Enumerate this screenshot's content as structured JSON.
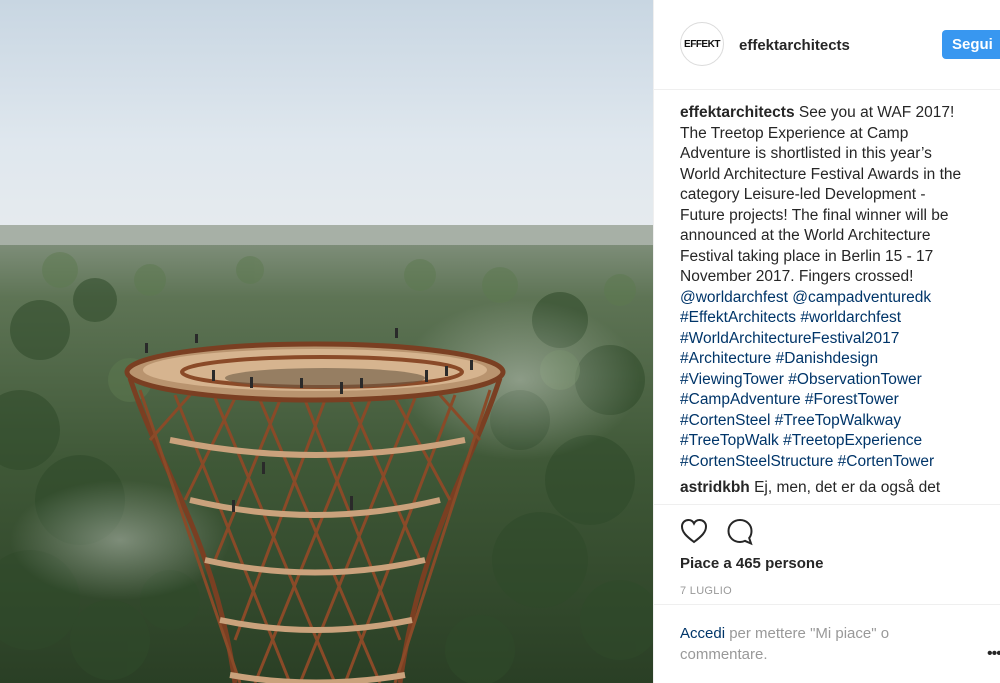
{
  "post": {
    "username": "effektarchitects",
    "avatar_text": "EFFEKT",
    "follow_label": "Segui",
    "caption": {
      "user": "effektarchitects",
      "text_lines": [
        "See you at WAF 2017!",
        "The Treetop Experience at Camp",
        "Adventure is shortlisted in this year’s",
        "World Architecture Festival Awards in the",
        "category Leisure-led Development -",
        "Future projects! The final winner will be",
        "announced at the World Architecture",
        "Festival taking place in Berlin 15 - 17",
        "November 2017. Fingers crossed!"
      ],
      "tag_lines": [
        "@worldarchfest @campadventuredk",
        "#EffektArchitects #worldarchfest",
        "#WorldArchitectureFestival2017",
        "#Architecture #Danishdesign",
        "#ViewingTower #ObservationTower",
        "#CampAdventure #ForestTower",
        "#CortenSteel #TreeTopWalkway",
        "#TreeTopWalk #TreetopExperience",
        "#CortenSteelStructure #CortenTower"
      ]
    },
    "comment2": {
      "user": "astridkbh",
      "text": "Ej, men, det er da også det"
    },
    "likes_text": "Piace a 465 persone",
    "date_text": "7 LUGLIO",
    "login_link": "Accedi",
    "login_text": " per mettere \"Mi piace\" o commentare.",
    "icons": {
      "like": "heart-icon",
      "comment": "comment-bubble-icon",
      "more": "more-options-icon"
    },
    "colors": {
      "follow_button": "#3897f0",
      "link": "#003569",
      "text": "#262626",
      "muted": "#999999"
    }
  }
}
